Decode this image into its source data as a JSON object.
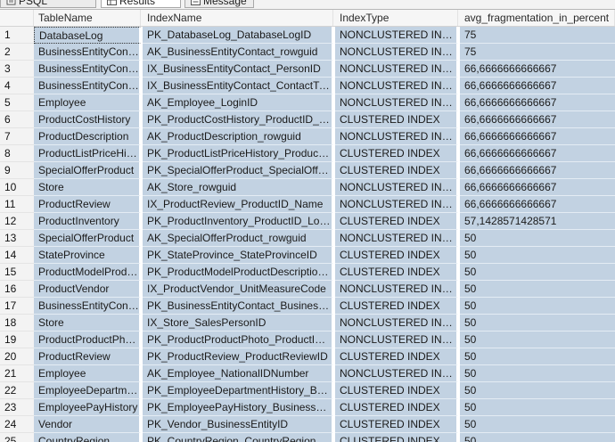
{
  "tabs": [
    {
      "label": "PSQL",
      "icon": "query-icon"
    },
    {
      "label": "Results",
      "icon": "grid-icon"
    },
    {
      "label": "Message",
      "icon": "message-icon"
    }
  ],
  "columns": [
    "TableName",
    "IndexName",
    "IndexType",
    "avg_fragmentation_in_percent"
  ],
  "colors": {
    "selection": "#c2d2e2",
    "header_bg": "#f6f6f6"
  },
  "rows": [
    {
      "n": "1",
      "table": "DatabaseLog",
      "index": "PK_DatabaseLog_DatabaseLogID",
      "type": "NONCLUSTERED INDEX",
      "frag": "75"
    },
    {
      "n": "2",
      "table": "BusinessEntityContact",
      "index": "AK_BusinessEntityContact_rowguid",
      "type": "NONCLUSTERED INDEX",
      "frag": "75"
    },
    {
      "n": "3",
      "table": "BusinessEntityContact",
      "index": "IX_BusinessEntityContact_PersonID",
      "type": "NONCLUSTERED INDEX",
      "frag": "66,6666666666667"
    },
    {
      "n": "4",
      "table": "BusinessEntityContact",
      "index": "IX_BusinessEntityContact_ContactTypeID",
      "type": "NONCLUSTERED INDEX",
      "frag": "66,6666666666667"
    },
    {
      "n": "5",
      "table": "Employee",
      "index": "AK_Employee_LoginID",
      "type": "NONCLUSTERED INDEX",
      "frag": "66,6666666666667"
    },
    {
      "n": "6",
      "table": "ProductCostHistory",
      "index": "PK_ProductCostHistory_ProductID_Star...",
      "type": "CLUSTERED INDEX",
      "frag": "66,6666666666667"
    },
    {
      "n": "7",
      "table": "ProductDescription",
      "index": "AK_ProductDescription_rowguid",
      "type": "NONCLUSTERED INDEX",
      "frag": "66,6666666666667"
    },
    {
      "n": "8",
      "table": "ProductListPriceHist...",
      "index": "PK_ProductListPriceHistory_ProductID_...",
      "type": "CLUSTERED INDEX",
      "frag": "66,6666666666667"
    },
    {
      "n": "9",
      "table": "SpecialOfferProduct",
      "index": "PK_SpecialOfferProduct_SpecialOfferID...",
      "type": "CLUSTERED INDEX",
      "frag": "66,6666666666667"
    },
    {
      "n": "10",
      "table": "Store",
      "index": "AK_Store_rowguid",
      "type": "NONCLUSTERED INDEX",
      "frag": "66,6666666666667"
    },
    {
      "n": "11",
      "table": "ProductReview",
      "index": "IX_ProductReview_ProductID_Name",
      "type": "NONCLUSTERED INDEX",
      "frag": "66,6666666666667"
    },
    {
      "n": "12",
      "table": "ProductInventory",
      "index": "PK_ProductInventory_ProductID_Locati...",
      "type": "CLUSTERED INDEX",
      "frag": "57,1428571428571"
    },
    {
      "n": "13",
      "table": "SpecialOfferProduct",
      "index": "AK_SpecialOfferProduct_rowguid",
      "type": "NONCLUSTERED INDEX",
      "frag": "50"
    },
    {
      "n": "14",
      "table": "StateProvince",
      "index": "PK_StateProvince_StateProvinceID",
      "type": "CLUSTERED INDEX",
      "frag": "50"
    },
    {
      "n": "15",
      "table": "ProductModelProdu...",
      "index": "PK_ProductModelProductDescriptionCul...",
      "type": "CLUSTERED INDEX",
      "frag": "50"
    },
    {
      "n": "16",
      "table": "ProductVendor",
      "index": "IX_ProductVendor_UnitMeasureCode",
      "type": "NONCLUSTERED INDEX",
      "frag": "50"
    },
    {
      "n": "17",
      "table": "BusinessEntityContact",
      "index": "PK_BusinessEntityContact_BusinessEnti...",
      "type": "CLUSTERED INDEX",
      "frag": "50"
    },
    {
      "n": "18",
      "table": "Store",
      "index": "IX_Store_SalesPersonID",
      "type": "NONCLUSTERED INDEX",
      "frag": "50"
    },
    {
      "n": "19",
      "table": "ProductProductPhoto",
      "index": "PK_ProductProductPhoto_ProductID_P...",
      "type": "NONCLUSTERED INDEX",
      "frag": "50"
    },
    {
      "n": "20",
      "table": "ProductReview",
      "index": "PK_ProductReview_ProductReviewID",
      "type": "CLUSTERED INDEX",
      "frag": "50"
    },
    {
      "n": "21",
      "table": "Employee",
      "index": "AK_Employee_NationalIDNumber",
      "type": "NONCLUSTERED INDEX",
      "frag": "50"
    },
    {
      "n": "22",
      "table": "EmployeeDepartmen...",
      "index": "PK_EmployeeDepartmentHistory_Busine...",
      "type": "CLUSTERED INDEX",
      "frag": "50"
    },
    {
      "n": "23",
      "table": "EmployeePayHistory",
      "index": "PK_EmployeePayHistory_BusinessEntity...",
      "type": "CLUSTERED INDEX",
      "frag": "50"
    },
    {
      "n": "24",
      "table": "Vendor",
      "index": "PK_Vendor_BusinessEntityID",
      "type": "CLUSTERED INDEX",
      "frag": "50"
    },
    {
      "n": "25",
      "table": "CountryRegion",
      "index": "PK_CountryRegion_CountryRegionCode",
      "type": "CLUSTERED INDEX",
      "frag": "50"
    }
  ]
}
